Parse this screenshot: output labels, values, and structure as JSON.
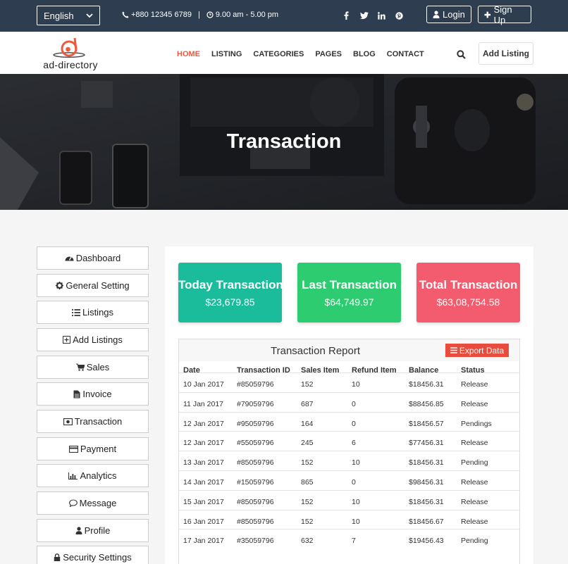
{
  "topbar": {
    "language": "English",
    "phone": "+880 12345 6789",
    "separator": "|",
    "hours": "9.00 am - 5.00 pm",
    "socials": [
      "facebook-icon",
      "twitter-icon",
      "linkedin-icon",
      "pinterest-icon"
    ],
    "login_label": "Login",
    "signup_label": "Sign Up"
  },
  "nav": {
    "logo_text": "ad-directory",
    "items": [
      "HOME",
      "LISTING",
      "CATEGORIES",
      "PAGES",
      "BLOG",
      "CONTACT"
    ],
    "active": "HOME",
    "add_listing_label": "Add Listing"
  },
  "hero": {
    "title": "Transaction"
  },
  "sidebar": {
    "items": [
      {
        "label": "Dashboard",
        "icon": "dashboard-icon"
      },
      {
        "label": "General Setting",
        "icon": "gear-icon"
      },
      {
        "label": "Listings",
        "icon": "list-icon"
      },
      {
        "label": "Add Listings",
        "icon": "plus-square-icon"
      },
      {
        "label": "Sales",
        "icon": "cart-icon"
      },
      {
        "label": "Invoice",
        "icon": "file-icon"
      },
      {
        "label": "Transaction",
        "icon": "money-icon"
      },
      {
        "label": "Payment",
        "icon": "credit-card-icon"
      },
      {
        "label": "Analytics",
        "icon": "bar-chart-icon"
      },
      {
        "label": "Message",
        "icon": "comment-icon"
      },
      {
        "label": "Profile",
        "icon": "user-icon"
      },
      {
        "label": "Security Settings",
        "icon": "lock-icon"
      }
    ]
  },
  "stats": [
    {
      "label": "Today Transaction",
      "value": "$23,679.85",
      "color": "#1abc9c"
    },
    {
      "label": "Last Transaction",
      "value": "$64,749.97",
      "color": "#2ecc71"
    },
    {
      "label": "Total Transaction",
      "value": "$63,08,754.58",
      "color": "#f25c6e"
    }
  ],
  "report": {
    "title": "Transaction Report",
    "export_label": "Export Data",
    "columns": [
      "Date",
      "Transaction ID",
      "Sales Item",
      "Refund Item",
      "Balance",
      "Status"
    ],
    "rows": [
      [
        "10 Jan 2017",
        "#85059796",
        "152",
        "10",
        "$18456.31",
        "Release"
      ],
      [
        "11 Jan 2017",
        "#79059796",
        "687",
        "0",
        "$88456.85",
        "Release"
      ],
      [
        "12 Jan 2017",
        "#95059796",
        "164",
        "0",
        "$18456.57",
        "Pendings"
      ],
      [
        "12 Jan 2017",
        "#55059796",
        "245",
        "6",
        "$77456.31",
        "Release"
      ],
      [
        "13 Jan 2017",
        "#85059796",
        "152",
        "10",
        "$18456.31",
        "Pending"
      ],
      [
        "14 Jan 2017",
        "#15059796",
        "865",
        "0",
        "$98456.31",
        "Release"
      ],
      [
        "15 Jan 2017",
        "#85059796",
        "152",
        "10",
        "$18456.31",
        "Release"
      ],
      [
        "16 Jan 2017",
        "#85059796",
        "152",
        "10",
        "$18456.67",
        "Release"
      ],
      [
        "17 Jan 2017",
        "#35059796",
        "632",
        "7",
        "$19456.43",
        "Pending"
      ]
    ]
  }
}
